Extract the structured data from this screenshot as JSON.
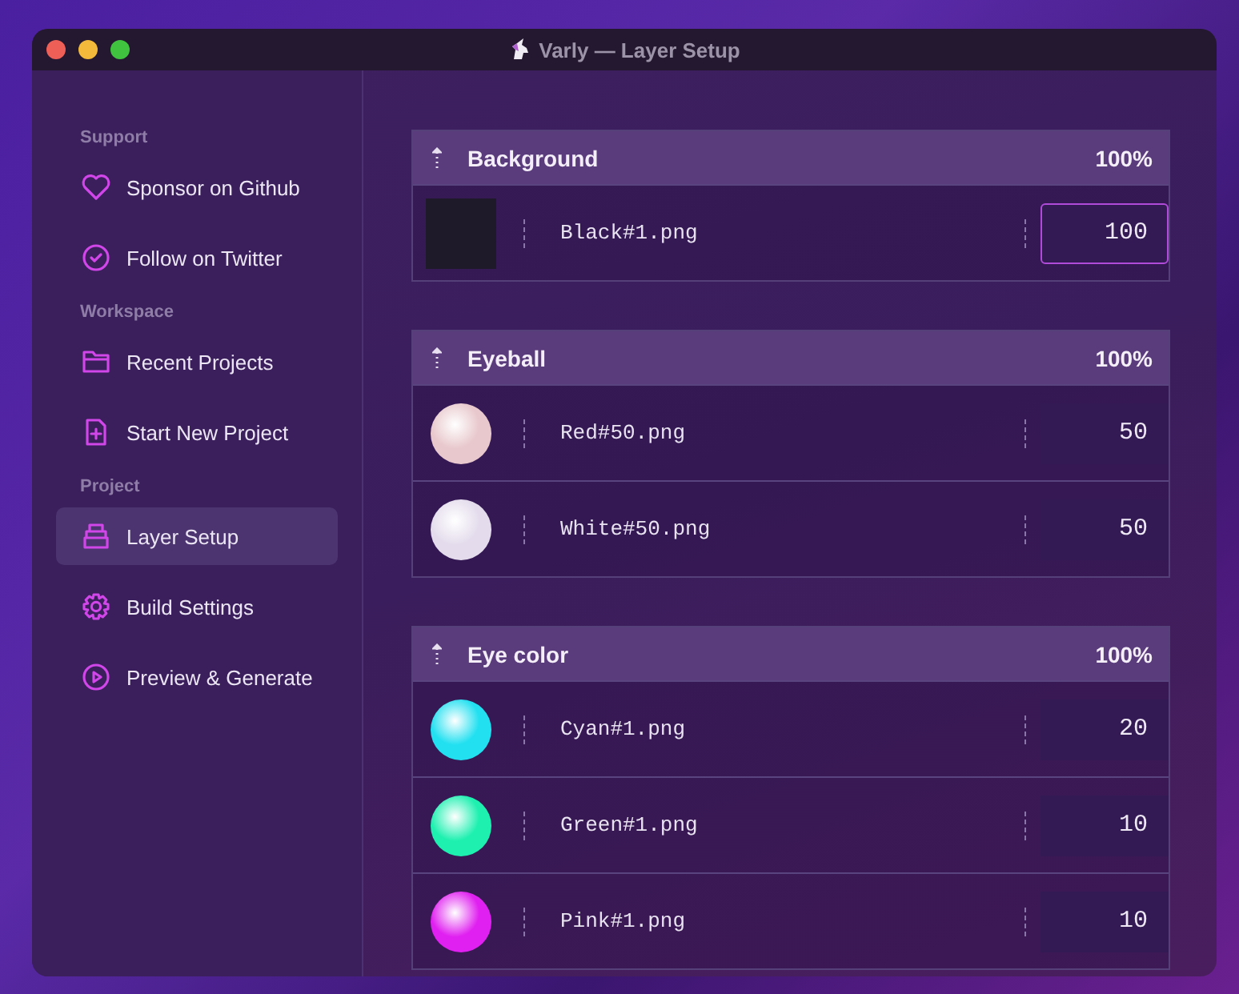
{
  "window": {
    "title": "Varly — Layer Setup"
  },
  "sidebar": {
    "sections": [
      {
        "heading": "Support",
        "items": [
          {
            "label": "Sponsor on Github",
            "kind": "heart",
            "selected": false
          },
          {
            "label": "Follow on Twitter",
            "kind": "badge",
            "selected": false
          }
        ]
      },
      {
        "heading": "Workspace",
        "items": [
          {
            "label": "Recent Projects",
            "kind": "folder",
            "selected": false
          },
          {
            "label": "Start New Project",
            "kind": "file",
            "selected": false
          }
        ]
      },
      {
        "heading": "Project",
        "items": [
          {
            "label": "Layer Setup",
            "kind": "layers",
            "selected": true
          },
          {
            "label": "Build Settings",
            "kind": "gear",
            "selected": false
          },
          {
            "label": "Preview & Generate",
            "kind": "play",
            "selected": false
          }
        ]
      }
    ]
  },
  "layers": [
    {
      "name": "Background",
      "percent": "100%",
      "traits": [
        {
          "file": "Black#1.png",
          "kind": "square",
          "color": "#1e1a2a",
          "value": "100",
          "focused": true
        }
      ]
    },
    {
      "name": "Eyeball",
      "percent": "100%",
      "traits": [
        {
          "file": "Red#50.png",
          "kind": "sphere",
          "color": "#e8c8cc",
          "value": "50",
          "focused": false
        },
        {
          "file": "White#50.png",
          "kind": "sphere",
          "color": "#e4dcec",
          "value": "50",
          "focused": false
        }
      ]
    },
    {
      "name": "Eye color",
      "percent": "100%",
      "traits": [
        {
          "file": "Cyan#1.png",
          "kind": "sphere",
          "color": "#22e0f0",
          "value": "20",
          "focused": false
        },
        {
          "file": "Green#1.png",
          "kind": "sphere",
          "color": "#1ef0b0",
          "value": "10",
          "focused": false
        },
        {
          "file": "Pink#1.png",
          "kind": "sphere",
          "color": "#e020f0",
          "value": "10",
          "focused": false
        }
      ]
    }
  ]
}
